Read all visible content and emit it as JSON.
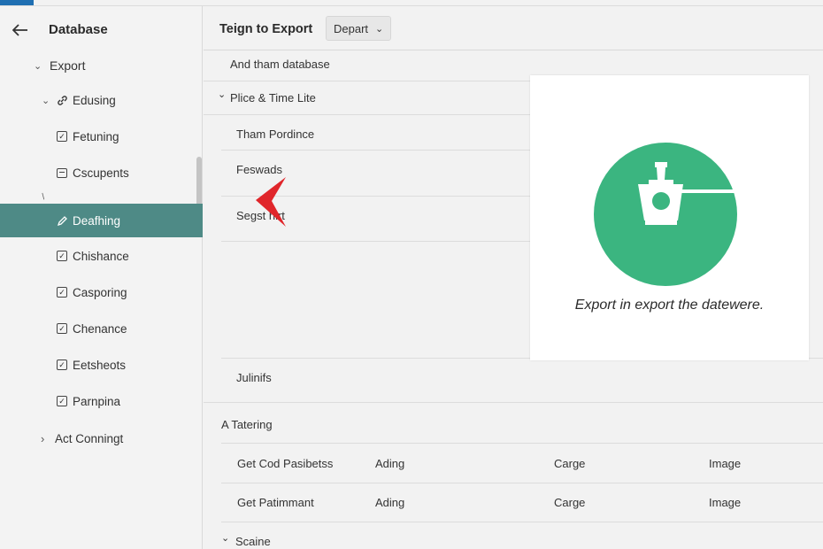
{
  "sidebar": {
    "title": "Database",
    "items": [
      {
        "label": "Export",
        "chevron": "down",
        "icon": "none"
      },
      {
        "label": "Edusing",
        "chevron": "down",
        "icon": "link-icon"
      },
      {
        "label": "Fetuning",
        "chevron": "none",
        "icon": "checkbox-icon"
      },
      {
        "label": "Cscupents",
        "chevron": "none",
        "icon": "document-icon"
      },
      {
        "label": "Deafhing",
        "chevron": "none",
        "icon": "pencil-icon",
        "selected": true
      },
      {
        "label": "Chishance",
        "chevron": "none",
        "icon": "checkbox-icon"
      },
      {
        "label": "Casporing",
        "chevron": "none",
        "icon": "checkbox-icon"
      },
      {
        "label": "Chenance",
        "chevron": "none",
        "icon": "checkbox-icon"
      },
      {
        "label": "Eetsheots",
        "chevron": "none",
        "icon": "checkbox-icon"
      },
      {
        "label": "Parnpina",
        "chevron": "none",
        "icon": "checkbox-icon"
      },
      {
        "label": "Act Conningt",
        "chevron": "right",
        "icon": "none"
      }
    ]
  },
  "main": {
    "title": "Teign to Export",
    "dropdown_label": "Depart",
    "rows": [
      {
        "label": "And tham database"
      },
      {
        "label": "Plice & Time Lite"
      },
      {
        "label": "Tham Pordince"
      },
      {
        "label": "Feswads"
      },
      {
        "label": "Segst hirt"
      },
      {
        "label": "Julinifs"
      }
    ],
    "section_label": "A Tatering",
    "table": {
      "rows": [
        {
          "name": "Get Cod Pasibetss",
          "col2": "Ading",
          "col3": "Carge",
          "col4": "Image"
        },
        {
          "name": "Get Patimmant",
          "col2": "Ading",
          "col3": "Carge",
          "col4": "Image"
        }
      ]
    },
    "footer_label": "Scaine"
  },
  "preview": {
    "caption": "Export in export the datewere.",
    "icon": "export-tool-icon",
    "circle_color": "#3bb580"
  },
  "colors": {
    "selected_item": "#4e8a86",
    "accent": "#1f6fb2",
    "cursor": "#e0262b"
  }
}
